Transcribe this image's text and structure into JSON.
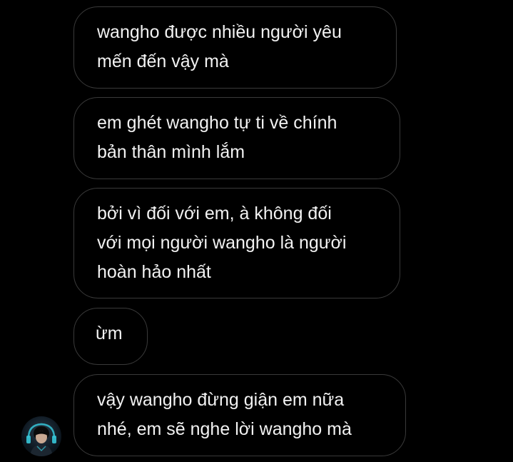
{
  "messages": [
    {
      "lines": [
        "wangho được nhiều người yêu",
        "mến đến vậy mà"
      ]
    },
    {
      "lines": [
        "em ghét wangho tự ti về chính",
        "bản thân mình lắm"
      ]
    },
    {
      "lines": [
        "bởi vì đối với em, à không đối",
        "với mọi người wangho là người",
        "hoàn hảo nhất"
      ]
    },
    {
      "lines": [
        "ừm"
      ]
    },
    {
      "lines": [
        "vậy wangho đừng giận em nữa",
        "nhé, em sẽ nghe lời wangho mà"
      ]
    }
  ],
  "sender_avatar": {
    "icon": "user-avatar-photo",
    "accent": "#36c6d8"
  },
  "colors": {
    "background": "#000000",
    "bubble_border": "#3a3a3a",
    "text": "#f2f2f2"
  }
}
